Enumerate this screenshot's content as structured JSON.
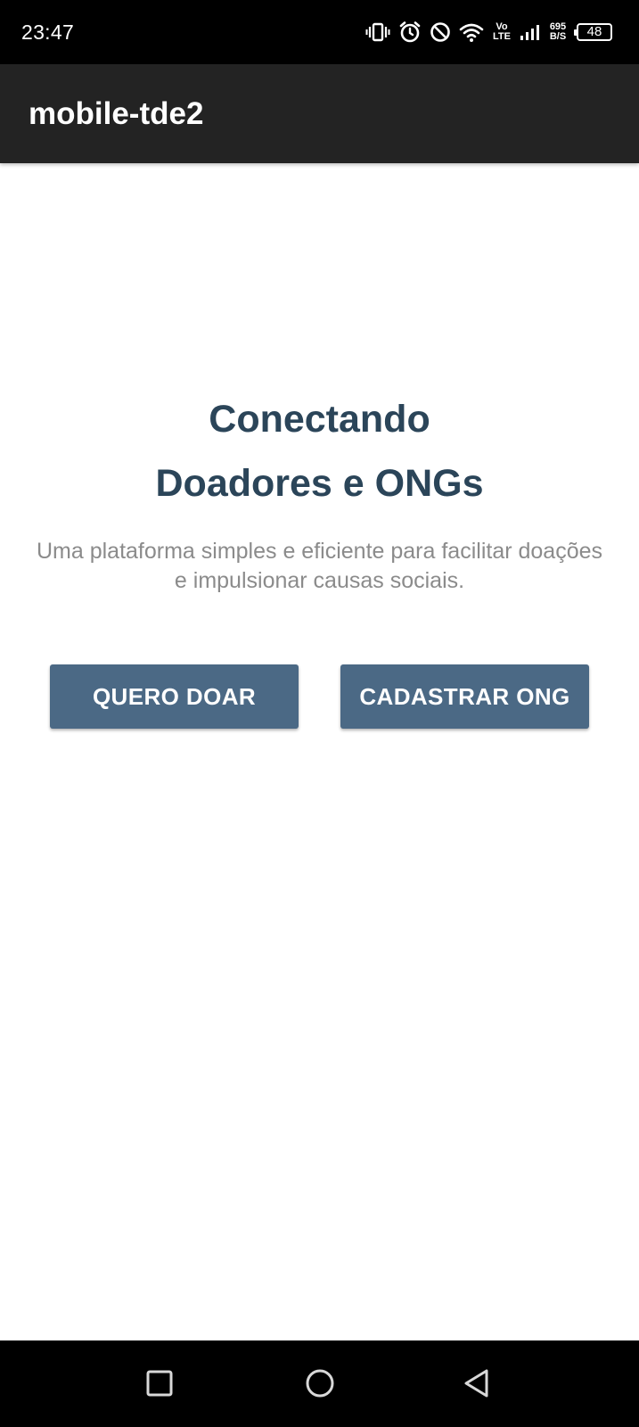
{
  "status_bar": {
    "time": "23:47",
    "icons": [
      "vibrate-icon",
      "alarm-icon",
      "do-not-disturb-icon",
      "wifi-icon",
      "volte-icon",
      "signal-icon"
    ],
    "volte_top": "Vo",
    "volte_bottom": "LTE",
    "net_speed_value": "695",
    "net_speed_unit": "B/S",
    "battery": "48"
  },
  "app_bar": {
    "title": "mobile-tde2",
    "background": "#232323"
  },
  "hero": {
    "title_line1": "Conectando",
    "title_line2": "Doadores e ONGs",
    "subtitle": "Uma plataforma simples e eficiente para facilitar doações e impulsionar causas sociais.",
    "title_color": "#2b4559",
    "subtitle_color": "#8b8b8b"
  },
  "actions": {
    "donate_label": "QUERO DOAR",
    "register_label": "CADASTRAR ONG",
    "button_color": "#4b6985"
  },
  "nav_bar": {
    "buttons": [
      "recents-icon",
      "home-icon",
      "back-icon"
    ]
  }
}
